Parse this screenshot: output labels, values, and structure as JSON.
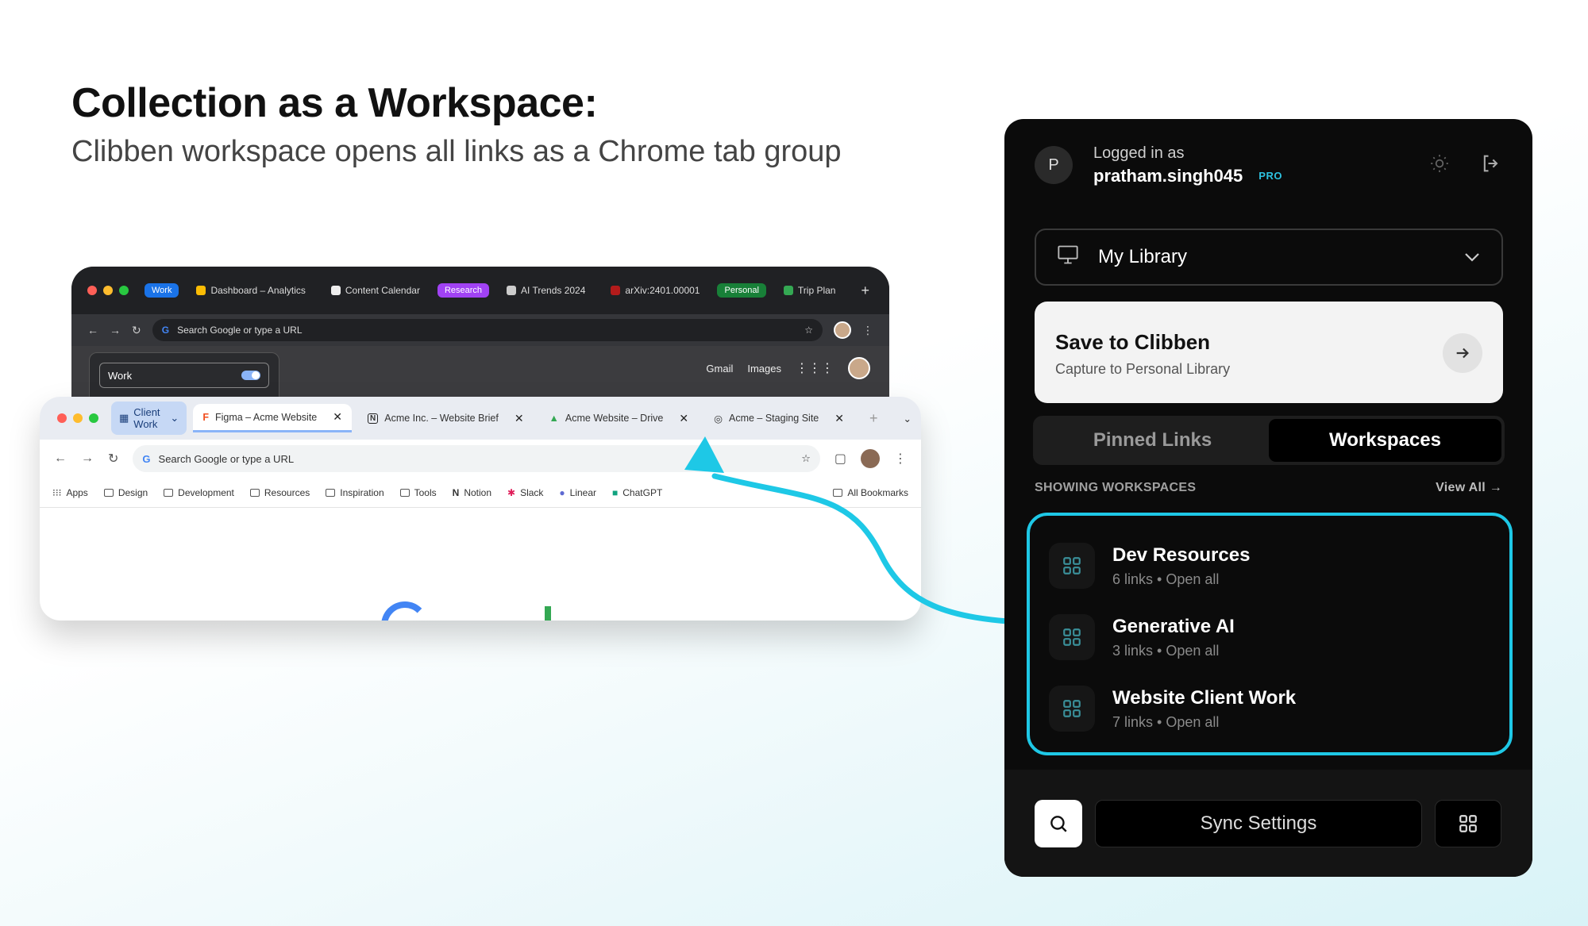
{
  "hero": {
    "title": "Collection as a Workspace:",
    "subtitle": "Clibben workspace opens all links as a Chrome tab group"
  },
  "back_browser": {
    "tabs": [
      {
        "label": "Work",
        "type": "group",
        "color": "#8ab4f8"
      },
      {
        "label": "Dashboard – Analytics",
        "type": "tab"
      },
      {
        "label": "Content Calendar",
        "type": "tab"
      },
      {
        "label": "Research",
        "type": "group",
        "color": "#c58af9"
      },
      {
        "label": "AI Trends 2024",
        "type": "tab"
      },
      {
        "label": "arXiv:2401.00001",
        "type": "tab"
      },
      {
        "label": "Personal",
        "type": "group",
        "color": "#81c995"
      },
      {
        "label": "Trip Plan",
        "type": "tab"
      }
    ],
    "address_placeholder": "Search Google or type a URL",
    "group_name_value": "Work",
    "links": {
      "gmail": "Gmail",
      "images": "Images"
    }
  },
  "front_browser": {
    "group_label": "Client Work",
    "tabs": [
      {
        "label": "Figma – Acme Website",
        "active": true
      },
      {
        "label": "Acme Inc. – Website Brief",
        "active": false
      },
      {
        "label": "Acme Website – Drive",
        "active": false
      },
      {
        "label": "Acme – Staging Site",
        "active": false
      }
    ],
    "address_placeholder": "Search Google or type a URL",
    "bookmarks": [
      "Apps",
      "Design",
      "Development",
      "Resources",
      "Inspiration",
      "Tools",
      "Notion",
      "Slack",
      "Linear",
      "ChatGPT"
    ],
    "all_bookmarks": "All Bookmarks"
  },
  "panel": {
    "avatar_letter": "P",
    "logged_in_label": "Logged in as",
    "username": "pratham.singh045",
    "badge": "PRO",
    "library_label": "My Library",
    "save": {
      "title": "Save to Clibben",
      "subtitle": "Capture to Personal Library"
    },
    "segments": [
      {
        "label": "Pinned Links",
        "active": false
      },
      {
        "label": "Workspaces",
        "active": true
      }
    ],
    "showing_label": "SHOWING WORKSPACES",
    "view_all": "View All →",
    "workspaces": [
      {
        "name": "Dev Resources",
        "meta": "6 links • Open all"
      },
      {
        "name": "Generative AI",
        "meta": "3 links • Open all"
      },
      {
        "name": "Website Client Work",
        "meta": "7 links • Open all"
      }
    ],
    "sync_label": "Sync Settings"
  },
  "colors": {
    "accent": "#1ec8e6",
    "panel_bg": "#0b0b0b"
  }
}
